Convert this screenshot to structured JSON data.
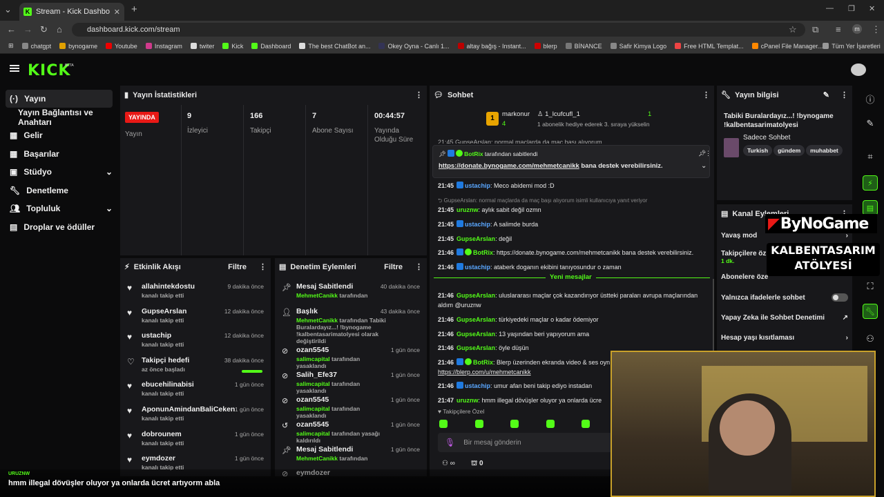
{
  "browser": {
    "tab_title": "Stream - Kick Dashboard",
    "url": "dashboard.kick.com/stream",
    "profile_initial": "m",
    "bookmarks": [
      "chatgpt",
      "bynogame",
      "Youtube",
      "Instagram",
      "twiter",
      "Kick",
      "Dashboard",
      "The best ChatBot an...",
      "Okey Oyna - Canlı 1...",
      "altay bağış - Instant...",
      "blerp",
      "BİNANCE",
      "Safir Kimya Logo",
      "Free HTML Templat...",
      "cPanel File Manager..."
    ],
    "all_bookmarks": "Tüm Yer İşaretleri"
  },
  "kick": {
    "logo": "KICK",
    "beta": "BETA"
  },
  "sidebar": [
    {
      "label": "Yayın",
      "icon": "broadcast-icon"
    },
    {
      "label": "Yayın Bağlantısı ve Anahtarı",
      "icon": ""
    },
    {
      "label": "Gelir",
      "icon": "income-icon"
    },
    {
      "label": "Başarılar",
      "icon": "trophy-icon"
    },
    {
      "label": "Stüdyo",
      "icon": "studio-icon"
    },
    {
      "label": "Denetleme",
      "icon": "wrench-icon"
    },
    {
      "label": "Topluluk",
      "icon": "community-icon"
    },
    {
      "label": "Droplar ve ödüller",
      "icon": "gift-icon"
    }
  ],
  "stats": {
    "title": "Yayın İstatistikleri",
    "live_badge": "YAYINDA",
    "live_label": "Yayın",
    "viewers_value": "9",
    "viewers_label": "İzleyici",
    "followers_value": "166",
    "followers_label": "Takipçi",
    "subs_value": "7",
    "subs_label": "Abone Sayısı",
    "duration_value": "00:44:57",
    "duration_label1": "Yayında",
    "duration_label2": "Olduğu Süre"
  },
  "activity": {
    "title": "Etkinlik Akışı",
    "filter": "Filtre",
    "items": [
      {
        "title": "allahintekdostu",
        "sub": "kanalı takip etti",
        "time": "9 dakika önce"
      },
      {
        "title": "GupseArslan",
        "sub": "kanalı takip etti",
        "time": "12 dakika önce"
      },
      {
        "title": "ustachip",
        "sub": "kanalı takip etti",
        "time": "12 dakika önce"
      },
      {
        "title": "Takipçi hedefi",
        "sub": "az önce başladı",
        "time": "38 dakika önce"
      },
      {
        "title": "ebucehilinabisi",
        "sub": "kanalı takip etti",
        "time": "1 gün önce"
      },
      {
        "title": "AponunAmindanBaliCeken",
        "sub": "kanalı takip etti",
        "time": "1 gün önce"
      },
      {
        "title": "dobrounem",
        "sub": "kanalı takip etti",
        "time": "1 gün önce"
      },
      {
        "title": "eymdozer",
        "sub": "kanalı takip etti",
        "time": "1 gün önce"
      }
    ]
  },
  "modlog": {
    "title": "Denetim Eylemleri",
    "filter": "Filtre",
    "items": [
      {
        "title": "Mesaj Sabitlendi",
        "actor": "MehmetCanikk",
        "action": "tarafından",
        "time": "40 dakika önce"
      },
      {
        "title": "Başlık",
        "actor": "MehmetCanikk",
        "action": "tarafından Tabiki Buralardayız...! !bynogame !kalbentasarimatolyesi olarak değiştirildi",
        "time": "43 dakika önce"
      },
      {
        "title": "ozan5545",
        "actor": "salimcapital",
        "action": "tarafından yasaklandı",
        "time": "1 gün önce"
      },
      {
        "title": "Salih_Efe37",
        "actor": "salimcapital",
        "action": "tarafından yasaklandı",
        "time": "1 gün önce"
      },
      {
        "title": "ozan5545",
        "actor": "salimcapital",
        "action": "tarafından yasaklandı",
        "time": "1 gün önce"
      },
      {
        "title": "ozan5545",
        "actor": "salimcapital",
        "action": "tarafından yasağı kaldırıldı",
        "time": "1 gün önce"
      },
      {
        "title": "Mesaj Sabitlendi",
        "actor": "MehmetCanikk",
        "action": "tarafından",
        "time": "1 gün önce"
      },
      {
        "title": "eymdozer",
        "actor": "",
        "action": "",
        "time": ""
      }
    ]
  },
  "chat": {
    "title": "Sohbet",
    "top_gifter": {
      "rank": "1",
      "name": "markonur",
      "count": "4",
      "sub_name": "1_lcufcufl_1",
      "sub_count": "1",
      "message": "1 abonelik hediye ederek 3. sıraya yükselin"
    },
    "partial_top": "21:45  GupseArslan: normal maçlarda da maç başı alıyorum",
    "pinned": {
      "by": "BotRix",
      "by_suffix": "tarafından sabitlendi",
      "link": "https://donate.bynogame.com/mehmetcanikk",
      "text": " bana destek verebilirsiniz."
    },
    "reply_context": "GupseArslan: normal maçlarda da maç başı alıyorum isimli kullanıcıya yanıt veriyor",
    "new_messages": "Yeni mesajlar",
    "messages": [
      {
        "time": "21:45",
        "user": "ustachip",
        "text": ": Meco abidemi mod :D",
        "color": "b",
        "badge": "mod"
      },
      {
        "time": "21:45",
        "user": "uruznw",
        "text": ": aylık sabit değil ozmn",
        "color": "g",
        "badge": ""
      },
      {
        "time": "21:45",
        "user": "ustachip",
        "text": ": A salimde burda",
        "color": "b",
        "badge": "mod"
      },
      {
        "time": "21:45",
        "user": "GupseArslan",
        "text": ": değil",
        "color": "g",
        "badge": ""
      },
      {
        "time": "21:46",
        "user": "BotRix",
        "text": ": https://donate.bynogame.com/mehmetcanikk bana destek verebilirsiniz.",
        "color": "g",
        "badge": "bot"
      },
      {
        "time": "21:46",
        "user": "ustachip",
        "text": ": ataberk doganın ekibini tanıyosundur o zaman",
        "color": "b",
        "badge": "mod"
      },
      {
        "time": "21:46",
        "user": "GupseArslan",
        "text": ": uluslararası maçlar çok kazandırıyor üstteki paraları avrupa maçlarından",
        "color": "g",
        "badge": ""
      },
      {
        "time": "",
        "user": "",
        "text": "aldım @uruznw",
        "color": "",
        "badge": ""
      },
      {
        "time": "21:46",
        "user": "GupseArslan",
        "text": ": türkiyedeki maçlar o kadar ödemiyor",
        "color": "g",
        "badge": ""
      },
      {
        "time": "21:46",
        "user": "GupseArslan",
        "text": ": 13 yaşından beri yapıyorum ama",
        "color": "g",
        "badge": ""
      },
      {
        "time": "21:46",
        "user": "GupseArslan",
        "text": ": öyle düşün",
        "color": "g",
        "badge": ""
      },
      {
        "time": "21:46",
        "user": "BotRix",
        "text": ": Blerp üzerinden ekranda video & ses oyn",
        "color": "g",
        "badge": "bot"
      },
      {
        "time": "",
        "user": "",
        "text": "https://blerp.com/u/mehmetcanikk",
        "color": "",
        "badge": ""
      },
      {
        "time": "21:46",
        "user": "ustachip",
        "text": ": umur afan beni takip ediyo instadan",
        "color": "b",
        "badge": "mod"
      },
      {
        "time": "21:47",
        "user": "uruznw",
        "text": ": hmm illegal dövüşler oluyor ya onlarda ücre",
        "color": "g",
        "badge": ""
      }
    ],
    "followers_only": "Takipçilere Özel",
    "placeholder": "Bir mesaj gönderin",
    "points": "0"
  },
  "stream_info": {
    "title": "Yayın bilgisi",
    "stream_title": "Tabiki Buralardayız...! !bynogame !kalbentasarimatolyesi",
    "category": "Sadece Sohbet",
    "tags": [
      "Turkish",
      "gündem",
      "muhabbet"
    ]
  },
  "channel_actions": {
    "title": "Kanal Eylemleri",
    "items": [
      {
        "label": "Yavaş mod",
        "control": "chevron"
      },
      {
        "label": "Takipçilere öz",
        "sub": "1 dk.",
        "control": "toggle"
      },
      {
        "label": "Abonelere öze",
        "control": "toggle"
      },
      {
        "label": "Yalnızca ifadelerle sohbet",
        "control": "toggle"
      },
      {
        "label": "Yapay Zeka ile Sohbet Denetimi",
        "control": "external"
      },
      {
        "label": "Hesap yaşı kısıtlaması",
        "control": "chevron"
      }
    ]
  },
  "overlay": {
    "brand": "ByNoGame",
    "line1": "KALBENTASARIM",
    "line2": "ATÖLYESİ",
    "subtitle_user": "URUZNW",
    "subtitle_text": "hmm illegal dövüşler oluyor ya onlarda ücret artıyorm abla"
  },
  "colors": {
    "kick_green": "#53fc18",
    "live_red": "#e91916",
    "mod_blue": "#5aa7ff"
  }
}
